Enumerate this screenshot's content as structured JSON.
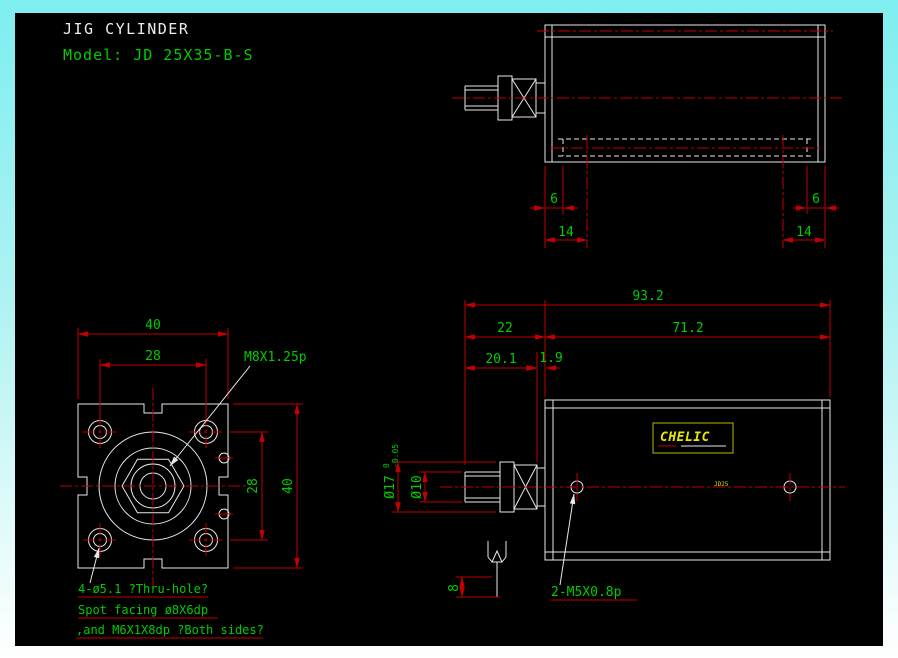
{
  "header": {
    "title": "JIG CYLINDER",
    "model": "Model: JD 25X35-B-S"
  },
  "colors": {
    "background_top": "#7eeef0",
    "background_bottom": "#ffffff",
    "canvas": "#000000",
    "geometry": "#e8e8e8",
    "dimension_red": "#c40000",
    "text_green": "#00cc00",
    "logo_yellow": "#e8e800"
  },
  "top_view": {
    "dim_6_left": "6",
    "dim_14_left": "14",
    "dim_6_right": "6",
    "dim_14_right": "14"
  },
  "front_view": {
    "dim_width_outer": "40",
    "dim_width_holes": "28",
    "dim_height_holes": "28",
    "dim_height_outer": "40",
    "thread_label": "M8X1.25p",
    "note_thru_hole": "4-ø5.1 ?Thru-hole?",
    "note_spot_facing": "Spot facing  ø8X6dp",
    "note_both_sides": ",and M6X1X8dp ?Both sides?"
  },
  "side_view": {
    "dim_total": "93.2",
    "dim_rod": "22",
    "dim_body": "71.2",
    "dim_20_1": "20.1",
    "dim_1_9": "1.9",
    "dim_dia17": "Ø17",
    "tol_upper": "0",
    "tol_lower": "-0.05",
    "dim_dia10": "Ø10",
    "dim_wrench": "8",
    "port_label": "2-M5X0.8p",
    "logo": "CHELIC",
    "stamp": "JD25"
  }
}
